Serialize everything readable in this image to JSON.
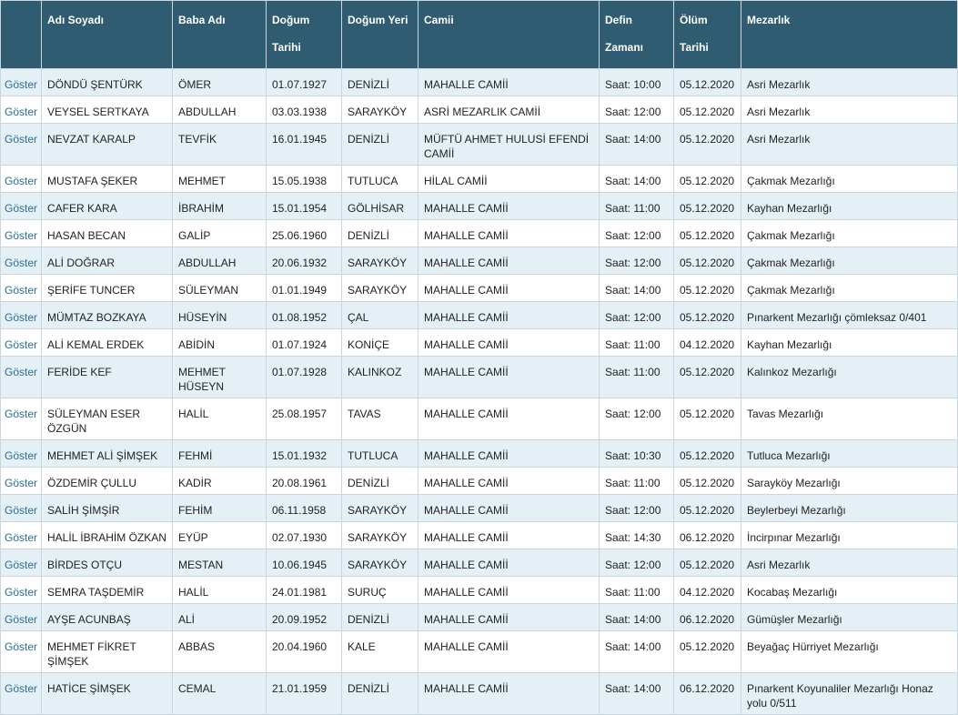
{
  "headers": [
    {
      "l1": "",
      "l2": ""
    },
    {
      "l1": "Adı Soyadı",
      "l2": ""
    },
    {
      "l1": "Baba Adı",
      "l2": ""
    },
    {
      "l1": "Doğum",
      "l2": "Tarihi"
    },
    {
      "l1": "Doğum Yeri",
      "l2": ""
    },
    {
      "l1": "Camii",
      "l2": ""
    },
    {
      "l1": "Defin",
      "l2": "Zamanı"
    },
    {
      "l1": "Ölüm",
      "l2": "Tarihi"
    },
    {
      "l1": "Mezarlık",
      "l2": ""
    }
  ],
  "show_label": "Göster",
  "rows": [
    {
      "name": "DÖNDÜ ŞENTÜRK",
      "father": "ÖMER",
      "birth_date": "01.07.1927",
      "birth_place": "DENİZLİ",
      "mosque": "MAHALLE CAMİİ",
      "burial_time": "Saat: 10:00",
      "death_date": "05.12.2020",
      "cemetery": "Asri Mezarlık"
    },
    {
      "name": "VEYSEL SERTKAYA",
      "father": "ABDULLAH",
      "birth_date": "03.03.1938",
      "birth_place": "SARAYKÖY",
      "mosque": "ASRİ MEZARLIK CAMİİ",
      "burial_time": "Saat: 12:00",
      "death_date": "05.12.2020",
      "cemetery": "Asri Mezarlık"
    },
    {
      "name": "NEVZAT KARALP",
      "father": "TEVFİK",
      "birth_date": "16.01.1945",
      "birth_place": "DENİZLİ",
      "mosque": "MÜFTÜ AHMET HULUSİ EFENDİ CAMİİ",
      "burial_time": "Saat: 14:00",
      "death_date": "05.12.2020",
      "cemetery": "Asri Mezarlık"
    },
    {
      "name": "MUSTAFA ŞEKER",
      "father": "MEHMET",
      "birth_date": "15.05.1938",
      "birth_place": "TUTLUCA",
      "mosque": "HİLAL CAMİİ",
      "burial_time": "Saat: 14:00",
      "death_date": "05.12.2020",
      "cemetery": "Çakmak Mezarlığı"
    },
    {
      "name": "CAFER KARA",
      "father": "İBRAHİM",
      "birth_date": "15.01.1954",
      "birth_place": "GÖLHİSAR",
      "mosque": "MAHALLE CAMİİ",
      "burial_time": "Saat: 11:00",
      "death_date": "05.12.2020",
      "cemetery": "Kayhan Mezarlığı"
    },
    {
      "name": "HASAN BECAN",
      "father": "GALİP",
      "birth_date": "25.06.1960",
      "birth_place": "DENİZLİ",
      "mosque": "MAHALLE CAMİİ",
      "burial_time": "Saat: 12:00",
      "death_date": "05.12.2020",
      "cemetery": "Çakmak Mezarlığı"
    },
    {
      "name": "ALİ DOĞRAR",
      "father": "ABDULLAH",
      "birth_date": "20.06.1932",
      "birth_place": "SARAYKÖY",
      "mosque": "MAHALLE CAMİİ",
      "burial_time": "Saat: 12:00",
      "death_date": "05.12.2020",
      "cemetery": "Çakmak Mezarlığı"
    },
    {
      "name": "ŞERİFE TUNCER",
      "father": "SÜLEYMAN",
      "birth_date": "01.01.1949",
      "birth_place": "SARAYKÖY",
      "mosque": "MAHALLE CAMİİ",
      "burial_time": "Saat: 14:00",
      "death_date": "05.12.2020",
      "cemetery": "Çakmak Mezarlığı"
    },
    {
      "name": "MÜMTAZ BOZKAYA",
      "father": "HÜSEYİN",
      "birth_date": "01.08.1952",
      "birth_place": "ÇAL",
      "mosque": "MAHALLE CAMİİ",
      "burial_time": "Saat: 12:00",
      "death_date": "05.12.2020",
      "cemetery": "Pınarkent Mezarlığı çömleksaz 0/401"
    },
    {
      "name": "ALİ KEMAL ERDEK",
      "father": "ABİDİN",
      "birth_date": "01.07.1924",
      "birth_place": "KONİÇE",
      "mosque": "MAHALLE CAMİİ",
      "burial_time": "Saat: 11:00",
      "death_date": "04.12.2020",
      "cemetery": "Kayhan Mezarlığı"
    },
    {
      "name": "FERİDE KEF",
      "father": "MEHMET HÜSEYN",
      "birth_date": "01.07.1928",
      "birth_place": "KALINKOZ",
      "mosque": "MAHALLE CAMİİ",
      "burial_time": "Saat: 11:00",
      "death_date": "05.12.2020",
      "cemetery": "Kalınkoz Mezarlığı"
    },
    {
      "name": "SÜLEYMAN ESER ÖZGÜN",
      "father": "HALİL",
      "birth_date": "25.08.1957",
      "birth_place": "TAVAS",
      "mosque": "MAHALLE CAMİİ",
      "burial_time": "Saat: 12:00",
      "death_date": "05.12.2020",
      "cemetery": "Tavas Mezarlığı"
    },
    {
      "name": "MEHMET ALİ ŞİMŞEK",
      "father": "FEHMİ",
      "birth_date": "15.01.1932",
      "birth_place": "TUTLUCA",
      "mosque": "MAHALLE CAMİİ",
      "burial_time": "Saat: 10:30",
      "death_date": "05.12.2020",
      "cemetery": "Tutluca Mezarlığı"
    },
    {
      "name": "ÖZDEMİR ÇULLU",
      "father": "KADİR",
      "birth_date": "20.08.1961",
      "birth_place": "DENİZLİ",
      "mosque": "MAHALLE CAMİİ",
      "burial_time": "Saat: 11:00",
      "death_date": "05.12.2020",
      "cemetery": "Sarayköy Mezarlığı"
    },
    {
      "name": "SALİH ŞİMŞİR",
      "father": "FEHİM",
      "birth_date": "06.11.1958",
      "birth_place": "SARAYKÖY",
      "mosque": "MAHALLE CAMİİ",
      "burial_time": "Saat: 12:00",
      "death_date": "05.12.2020",
      "cemetery": "Beylerbeyi Mezarlığı"
    },
    {
      "name": "HALİL İBRAHİM ÖZKAN",
      "father": "EYÜP",
      "birth_date": "02.07.1930",
      "birth_place": "SARAYKÖY",
      "mosque": "MAHALLE CAMİİ",
      "burial_time": "Saat: 14:30",
      "death_date": "06.12.2020",
      "cemetery": "İncirpınar Mezarlığı"
    },
    {
      "name": "BİRDES OTÇU",
      "father": "MESTAN",
      "birth_date": "10.06.1945",
      "birth_place": "SARAYKÖY",
      "mosque": "MAHALLE CAMİİ",
      "burial_time": "Saat: 12:00",
      "death_date": "05.12.2020",
      "cemetery": "Asri Mezarlık"
    },
    {
      "name": "SEMRA TAŞDEMİR",
      "father": "HALİL",
      "birth_date": "24.01.1981",
      "birth_place": "SURUÇ",
      "mosque": "MAHALLE CAMİİ",
      "burial_time": "Saat: 11:00",
      "death_date": "04.12.2020",
      "cemetery": "Kocabaş Mezarlığı"
    },
    {
      "name": "AYŞE ACUNBAŞ",
      "father": "ALİ",
      "birth_date": "20.09.1952",
      "birth_place": "DENİZLİ",
      "mosque": "MAHALLE CAMİİ",
      "burial_time": "Saat: 14:00",
      "death_date": "06.12.2020",
      "cemetery": "Gümüşler Mezarlığı"
    },
    {
      "name": "MEHMET FİKRET ŞİMŞEK",
      "father": "ABBAS",
      "birth_date": "20.04.1960",
      "birth_place": "KALE",
      "mosque": "MAHALLE CAMİİ",
      "burial_time": "Saat: 14:00",
      "death_date": "05.12.2020",
      "cemetery": "Beyağaç Hürriyet Mezarlığı"
    },
    {
      "name": "HATİCE ŞİMŞEK",
      "father": "CEMAL",
      "birth_date": "21.01.1959",
      "birth_place": "DENİZLİ",
      "mosque": "MAHALLE CAMİİ",
      "burial_time": "Saat: 14:00",
      "death_date": "06.12.2020",
      "cemetery": "Pınarkent Koyunaliler Mezarlığı Honaz yolu 0/511"
    }
  ]
}
